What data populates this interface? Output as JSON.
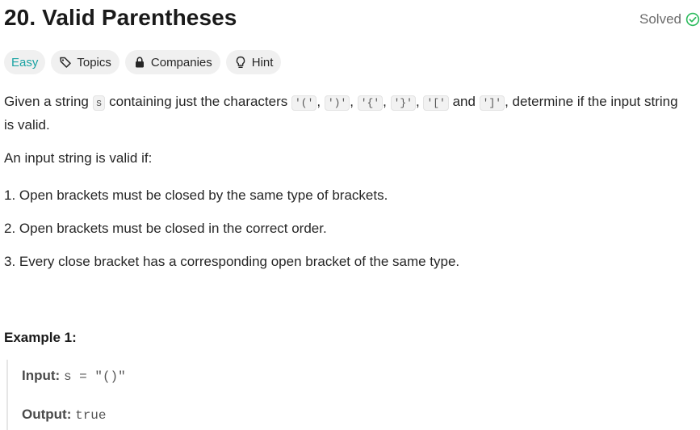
{
  "problem": {
    "title": "20. Valid Parentheses",
    "status": "Solved",
    "status_color": "#2cbb5d"
  },
  "tags": {
    "difficulty": "Easy",
    "topics": "Topics",
    "companies": "Companies",
    "hint": "Hint"
  },
  "description": {
    "p1_a": "Given a string ",
    "p1_code_s": "s",
    "p1_b": " containing just the characters ",
    "chars": [
      "'('",
      "')'",
      "'{'",
      "'}'",
      "'['",
      "']'"
    ],
    "sep1": ", ",
    "sep_and": " and ",
    "p1_c": ", determine if the input string is valid.",
    "p2": "An input string is valid if:",
    "rules": [
      "1. Open brackets must be closed by the same type of brackets.",
      "2. Open brackets must be closed in the correct order.",
      "3. Every close bracket has a corresponding open bracket of the same type."
    ]
  },
  "example1": {
    "title": "Example 1:",
    "input_label": "Input:",
    "input_value": "s = \"()\"",
    "output_label": "Output:",
    "output_value": "true"
  }
}
